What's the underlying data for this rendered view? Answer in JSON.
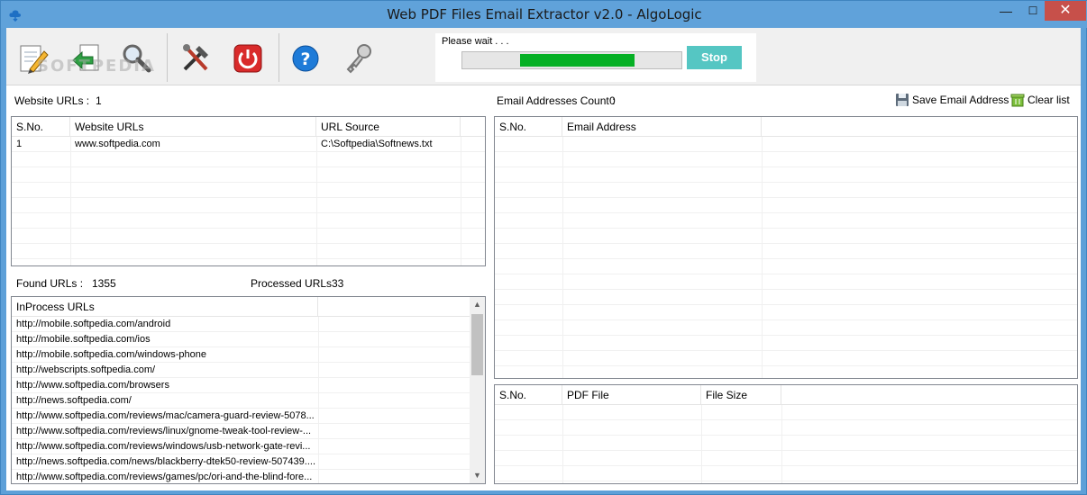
{
  "window": {
    "title": "Web PDF Files Email Extractor v2.0 - AlgoLogic",
    "minimize": "—",
    "maximize": "☐",
    "close": "✕"
  },
  "toolbar": {
    "watermark": "SOFTPEDIA",
    "progress": {
      "label": "Please wait . . .",
      "fill_start": 0.265,
      "fill_end": 0.785,
      "stop_label": "Stop"
    }
  },
  "website": {
    "label": "Website URLs :",
    "count": "1",
    "columns": [
      "S.No.",
      "Website URLs",
      "URL Source"
    ],
    "rows": [
      [
        "1",
        "www.softpedia.com",
        "C:\\Softpedia\\Softnews.txt"
      ]
    ]
  },
  "found": {
    "label": "Found URLs :",
    "count": "1355"
  },
  "processed": {
    "label": "Processed URLs",
    "count": "33"
  },
  "inprocess": {
    "column": "InProcess URLs",
    "rows": [
      "http://mobile.softpedia.com/android",
      "http://mobile.softpedia.com/ios",
      "http://mobile.softpedia.com/windows-phone",
      "http://webscripts.softpedia.com/",
      "http://www.softpedia.com/browsers",
      "http://news.softpedia.com/",
      "http://www.softpedia.com/reviews/mac/camera-guard-review-5078...",
      "http://www.softpedia.com/reviews/linux/gnome-tweak-tool-review-...",
      "http://www.softpedia.com/reviews/windows/usb-network-gate-revi...",
      "http://news.softpedia.com/news/blackberry-dtek50-review-507439....",
      "http://www.softpedia.com/reviews/games/pc/ori-and-the-blind-fore..."
    ]
  },
  "email": {
    "label": "Email Addresses Count :",
    "count": "0",
    "save_label": "Save Email Address",
    "clear_label": "Clear list",
    "columns": [
      "S.No.",
      "Email Address"
    ]
  },
  "pdf": {
    "columns": [
      "S.No.",
      "PDF File",
      "File Size"
    ]
  }
}
